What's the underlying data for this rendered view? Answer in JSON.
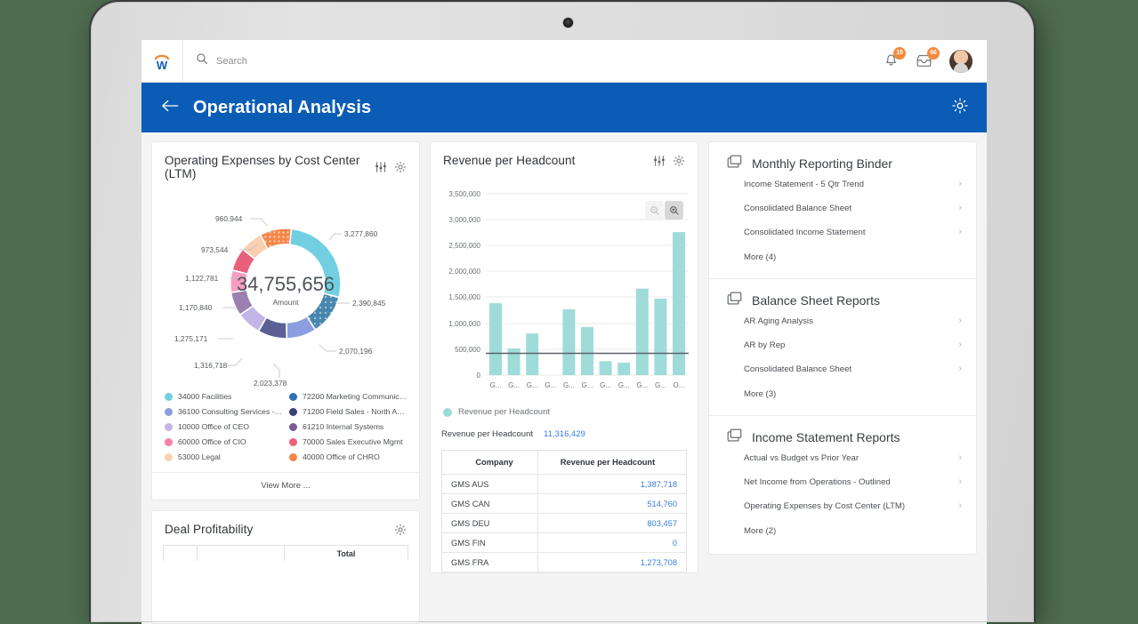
{
  "appbar": {
    "logo_icon": "workday-logo",
    "search_placeholder": "Search",
    "search_icon": "search-icon",
    "notifications": {
      "icon": "bell-icon",
      "badge": "15"
    },
    "inbox": {
      "icon": "inbox-icon",
      "badge": "66"
    },
    "avatar": "user-avatar"
  },
  "header": {
    "back_icon": "back-arrow-icon",
    "title": "Operational Analysis",
    "settings_icon": "gear-icon"
  },
  "cards": {
    "expenses": {
      "title": "Operating Expenses by Cost Center (LTM)",
      "filter_icon": "sliders-icon",
      "gear_icon": "gear-icon",
      "center_value": "34,755,656",
      "center_label": "Amount",
      "view_more": "View More ..."
    },
    "revenue": {
      "title": "Revenue per Headcount",
      "filter_icon": "sliders-icon",
      "gear_icon": "gear-icon",
      "zoom_out_icon": "zoom-out-icon",
      "zoom_in_icon": "zoom-in-icon",
      "series_legend": "Revenue per Headcount",
      "kpi_label": "Revenue per Headcount",
      "kpi_value": "11,316,429"
    },
    "deal": {
      "title": "Deal Profitability",
      "gear_icon": "gear-icon",
      "table_header_total": "Total"
    }
  },
  "chart_data": [
    {
      "type": "pie",
      "title": "Operating Expenses by Cost Center (LTM)",
      "center_total": "34,755,656",
      "center_label": "Amount",
      "slices": [
        {
          "label": "34000 Facilities",
          "value": 3277860,
          "value_text": "3,277,860",
          "color": "#72cfe2",
          "pattern": "none"
        },
        {
          "label": "36100 Consulting Services - N...",
          "value": 2390845,
          "value_text": "2,390,845",
          "color": "#4a87ae",
          "pattern": "dots"
        },
        {
          "label": "10000 Office of CEO",
          "value": 2070196,
          "value_text": "2,070,196",
          "color": "#8b9ee0",
          "pattern": "none"
        },
        {
          "label": "60000 Office of CIO",
          "value": 2023378,
          "value_text": "2,023,378",
          "color": "#5b5f96",
          "pattern": "none"
        },
        {
          "label": "53000 Legal",
          "value": 1316718,
          "value_text": "1,316,718",
          "color": "#c4b5e8",
          "pattern": "none"
        },
        {
          "label": "72200 Marketing Communicat...",
          "value": 1275171,
          "value_text": "1,275,171",
          "color": "#9b7fae",
          "pattern": "none"
        },
        {
          "label": "71200 Field Sales - North Ame...",
          "value": 1170840,
          "value_text": "1,170,840",
          "color": "#f79ec0",
          "pattern": "none"
        },
        {
          "label": "61210 Internal Systems",
          "value": 1122781,
          "value_text": "1,122,781",
          "color": "#e8607c",
          "pattern": "none"
        },
        {
          "label": "70000 Sales Executive Mgmt",
          "value": 973544,
          "value_text": "973,544",
          "color": "#fbd0b0",
          "pattern": "none"
        },
        {
          "label": "40000 Office of CHRO",
          "value": 960944,
          "value_text": "960,944",
          "color": "#f5854a",
          "pattern": "dots"
        }
      ],
      "legend_position": "bottom",
      "legend": [
        {
          "label": "34000 Facilities",
          "color": "#72cfe2"
        },
        {
          "label": "72200 Marketing Communicat...",
          "color": "#2f6fb5"
        },
        {
          "label": "36100 Consulting Services - N...",
          "color": "#8b9ee0"
        },
        {
          "label": "71200 Field Sales - North Ame...",
          "color": "#3a3f7a"
        },
        {
          "label": "10000 Office of CEO",
          "color": "#c4b5e8"
        },
        {
          "label": "61210 Internal Systems",
          "color": "#7a5d96"
        },
        {
          "label": "60000 Office of CIO",
          "color": "#f77fa8"
        },
        {
          "label": "70000 Sales Executive Mgmt",
          "color": "#ef5f7e"
        },
        {
          "label": "53000 Legal",
          "color": "#fbd0b0"
        },
        {
          "label": "40000 Office of CHRO",
          "color": "#f5854a"
        }
      ]
    },
    {
      "type": "bar",
      "title": "Revenue per Headcount",
      "xlabel": "",
      "ylabel": "",
      "ylim": [
        0,
        3500000
      ],
      "yticks": [
        "0",
        "500,000",
        "1,000,000",
        "1,500,000",
        "2,000,000",
        "2,500,000",
        "3,000,000",
        "3,500,000"
      ],
      "grid": true,
      "bar_color": "#9fdcd9",
      "reference_line": 420000,
      "categories": [
        "G...",
        "G...",
        "G...",
        "G...",
        "G...",
        "G...",
        "G...",
        "G...",
        "G...",
        "G...",
        "O..."
      ],
      "values": [
        1387718,
        514760,
        803457,
        0,
        1273708,
        930000,
        270000,
        240000,
        1670000,
        1475000,
        2760000
      ],
      "series": [
        {
          "name": "Revenue per Headcount",
          "values": [
            1387718,
            514760,
            803457,
            0,
            1273708,
            930000,
            270000,
            240000,
            1670000,
            1475000,
            2760000
          ]
        }
      ]
    },
    {
      "type": "table",
      "title": "Revenue per Headcount",
      "columns": [
        "Company",
        "Revenue per Headcount"
      ],
      "rows": [
        [
          "GMS AUS",
          "1,387,718"
        ],
        [
          "GMS CAN",
          "514,760"
        ],
        [
          "GMS DEU",
          "803,457"
        ],
        [
          "GMS FIN",
          "0"
        ],
        [
          "GMS FRA",
          "1,273,708"
        ]
      ]
    }
  ],
  "binder_sections": [
    {
      "icon": "binder-icon",
      "title": "Monthly Reporting Binder",
      "items": [
        "Income Statement - 5 Qtr Trend",
        "Consolidated Balance Sheet",
        "Consolidated Income Statement"
      ],
      "more": "More (4)"
    },
    {
      "icon": "binder-icon",
      "title": "Balance Sheet Reports",
      "items": [
        "AR Aging Analysis",
        "AR by Rep",
        "Consolidated Balance Sheet"
      ],
      "more": "More (3)"
    },
    {
      "icon": "binder-icon",
      "title": "Income Statement Reports",
      "items": [
        "Actual vs Budget vs Prior Year",
        "Net Income from Operations - Outlined",
        "Operating Expenses by Cost Center (LTM)"
      ],
      "more": "More (2)"
    }
  ],
  "colors": {
    "brand_blue": "#0b5cb5",
    "badge_orange": "#f28b3c",
    "link_blue": "#3b7ddb",
    "bar_teal": "#9fdcd9",
    "background_green": "#4e6b50"
  }
}
